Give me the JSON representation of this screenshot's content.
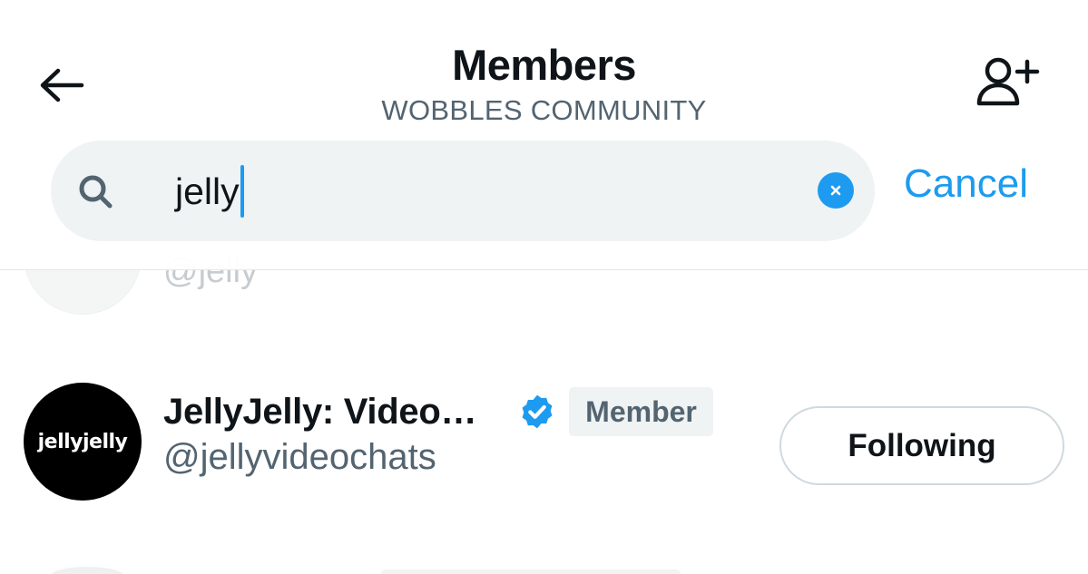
{
  "header": {
    "title": "Members",
    "subtitle": "WOBBLES COMMUNITY",
    "back_icon": "arrow-left-icon",
    "add_member_icon": "add-person-icon"
  },
  "search": {
    "value": "jelly",
    "placeholder": "",
    "search_icon": "search-icon",
    "clear_icon": "clear-x-icon",
    "cancel_label": "Cancel"
  },
  "members": [
    {
      "handle": "@jelly"
    },
    {
      "avatar_text": "jellyjelly",
      "display_name": "JellyJelly: Video…",
      "verified": true,
      "badge": "Member",
      "handle": "@jellyvideochats",
      "follow_label": "Following"
    }
  ],
  "colors": {
    "accent": "#1d9bf0",
    "text_primary": "#0f1419",
    "text_secondary": "#536471",
    "search_bg": "#eff3f4"
  }
}
